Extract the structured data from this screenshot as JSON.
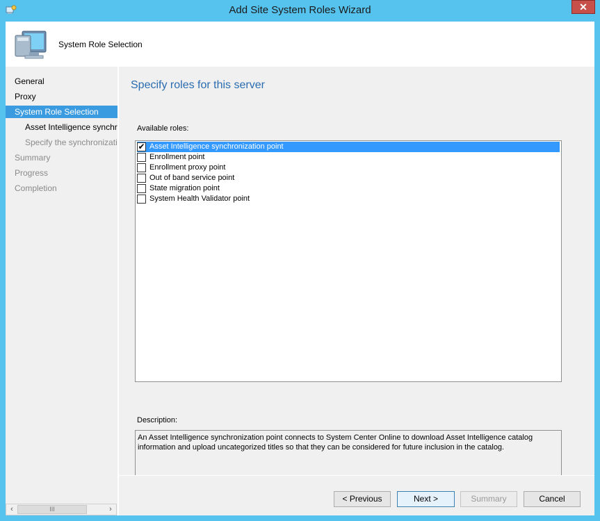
{
  "window": {
    "title": "Add Site System Roles Wizard",
    "close_glyph": "✕"
  },
  "header": {
    "title": "System Role Selection"
  },
  "nav": {
    "items": [
      {
        "label": "General",
        "state": "done"
      },
      {
        "label": "Proxy",
        "state": "done"
      },
      {
        "label": "System Role Selection",
        "state": "selected"
      },
      {
        "label": "Asset Intelligence synchronization point",
        "state": "sub"
      },
      {
        "label": "Specify the synchronization",
        "state": "sub-dim"
      },
      {
        "label": "Summary",
        "state": "dim"
      },
      {
        "label": "Progress",
        "state": "dim"
      },
      {
        "label": "Completion",
        "state": "dim"
      }
    ],
    "scroll_left": "‹",
    "scroll_thumb": "III",
    "scroll_right": "›"
  },
  "main": {
    "heading": "Specify roles for this server",
    "roles_label": "Available roles:",
    "roles": [
      {
        "label": "Asset Intelligence synchronization point",
        "checked": true,
        "selected": true
      },
      {
        "label": "Enrollment point",
        "checked": false
      },
      {
        "label": "Enrollment proxy point",
        "checked": false
      },
      {
        "label": "Out of band service point",
        "checked": false
      },
      {
        "label": "State migration point",
        "checked": false
      },
      {
        "label": "System Health Validator point",
        "checked": false
      }
    ],
    "check_glyph": "✔",
    "description_label": "Description:",
    "description": "An Asset Intelligence synchronization point connects to System Center Online to download Asset Intelligence catalog information and upload uncategorized titles so that they can be considered for future inclusion in the catalog."
  },
  "buttons": {
    "previous": "< Previous",
    "next": "Next >",
    "summary": "Summary",
    "cancel": "Cancel"
  },
  "colors": {
    "accent": "#3a9be0",
    "frame": "#56c3ef",
    "heading": "#2a6cb0",
    "selection": "#3399ff"
  }
}
